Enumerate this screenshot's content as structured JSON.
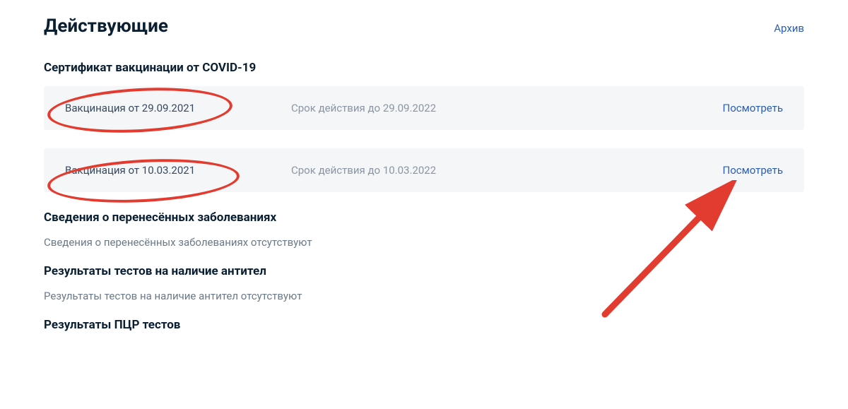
{
  "header": {
    "title": "Действующие",
    "archive": "Архив"
  },
  "sections": {
    "vaccination": {
      "title": "Сертификат вакцинации от COVID-19",
      "cards": [
        {
          "name": "Вакцинация от 29.09.2021",
          "expiry": "Срок действия до 29.09.2022",
          "action": "Посмотреть"
        },
        {
          "name": "Вакцинация от 10.03.2021",
          "expiry": "Срок действия до 10.03.2022",
          "action": "Посмотреть"
        }
      ]
    },
    "illness": {
      "title": "Сведения о перенесённых заболеваниях",
      "empty": "Сведения о перенесённых заболеваниях отсутствуют"
    },
    "antibody": {
      "title": "Результаты тестов на наличие антител",
      "empty": "Результаты тестов на наличие антител отсутствуют"
    },
    "pcr": {
      "title": "Результаты ПЦР тестов"
    }
  }
}
